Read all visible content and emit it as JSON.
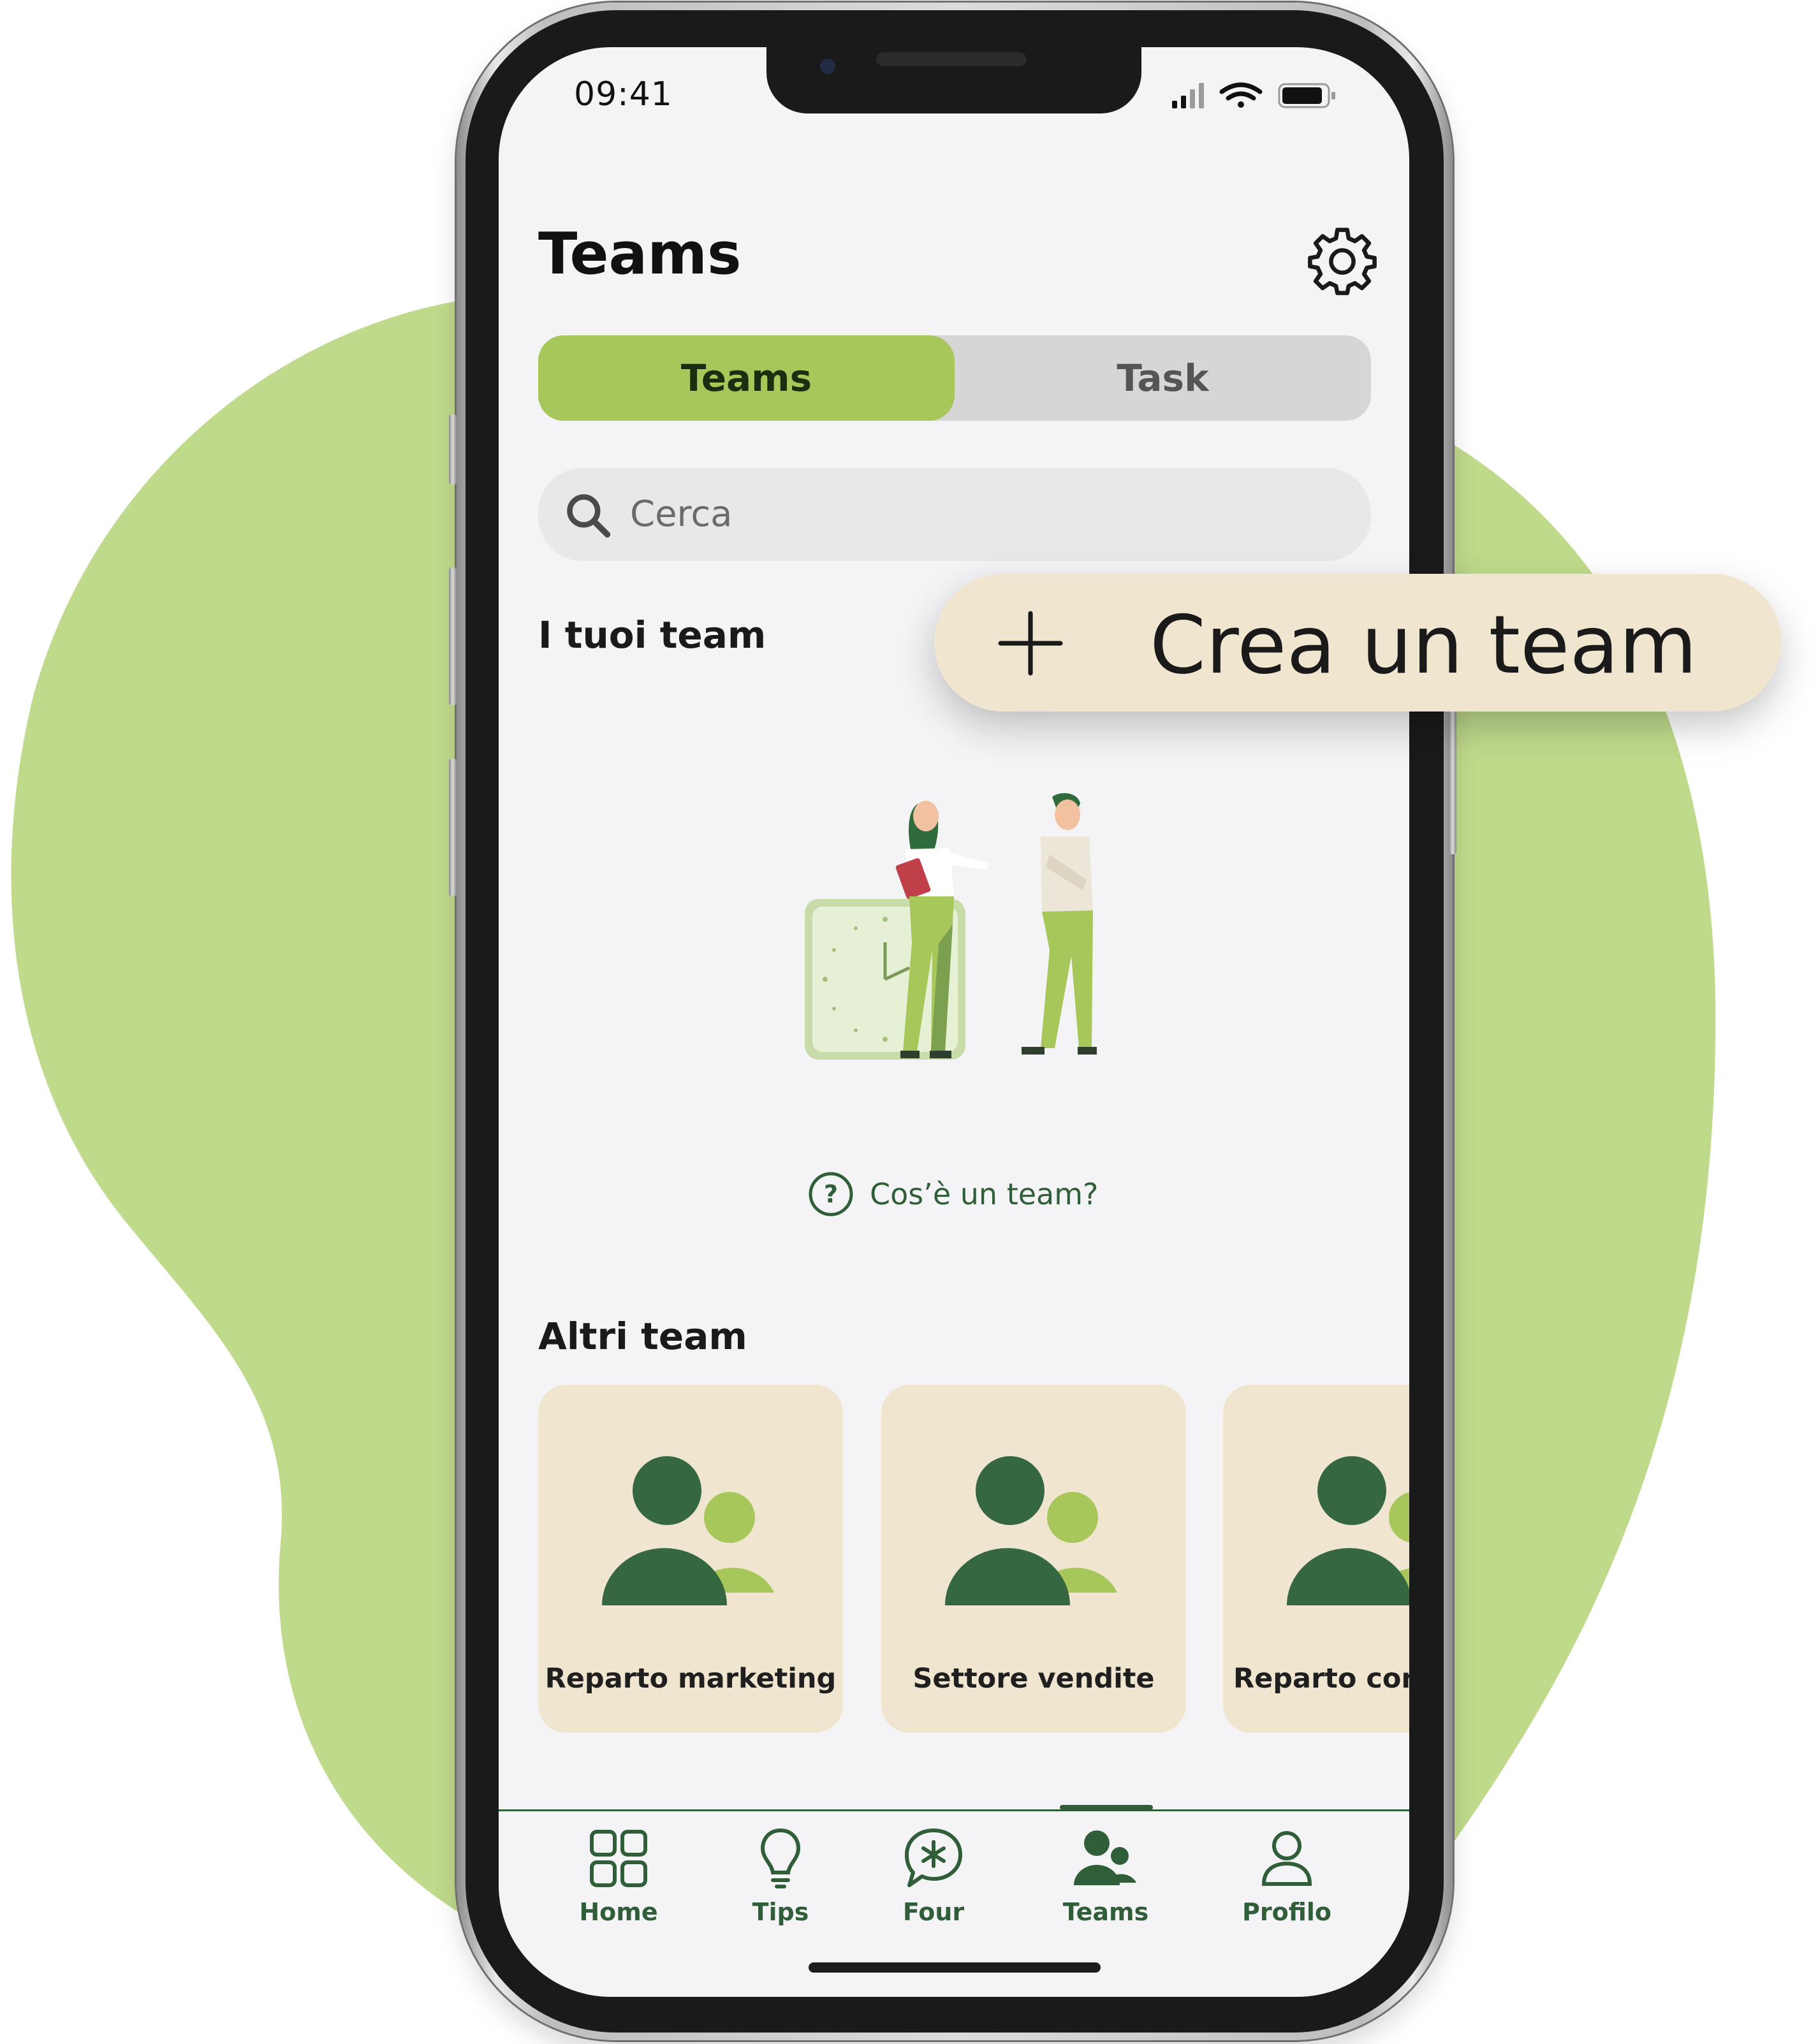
{
  "status_bar": {
    "time": "09:41"
  },
  "header": {
    "title": "Teams"
  },
  "segments": [
    {
      "label": "Teams",
      "active": true
    },
    {
      "label": "Task",
      "active": false
    }
  ],
  "search": {
    "placeholder": "Cerca"
  },
  "my_teams": {
    "heading": "I tuoi team",
    "help_text": "Cos’è un team?"
  },
  "other_teams": {
    "heading": "Altri team",
    "cards": [
      {
        "label": "Reparto marketing"
      },
      {
        "label": "Settore vendite"
      },
      {
        "label": "Reparto cons"
      }
    ]
  },
  "tabbar": {
    "items": [
      {
        "label": "Home",
        "icon": "grid-icon"
      },
      {
        "label": "Tips",
        "icon": "lightbulb-icon"
      },
      {
        "label": "Four",
        "icon": "chat-star-icon"
      },
      {
        "label": "Teams",
        "icon": "people-icon",
        "active": true
      },
      {
        "label": "Profilo",
        "icon": "user-icon"
      }
    ]
  },
  "callout": {
    "label": "Crea un team"
  },
  "colors": {
    "accent_green": "#a7c75a",
    "dark_green": "#2f5e38",
    "blob_green": "#c0da8c",
    "card_beige": "#f0e6d0"
  }
}
